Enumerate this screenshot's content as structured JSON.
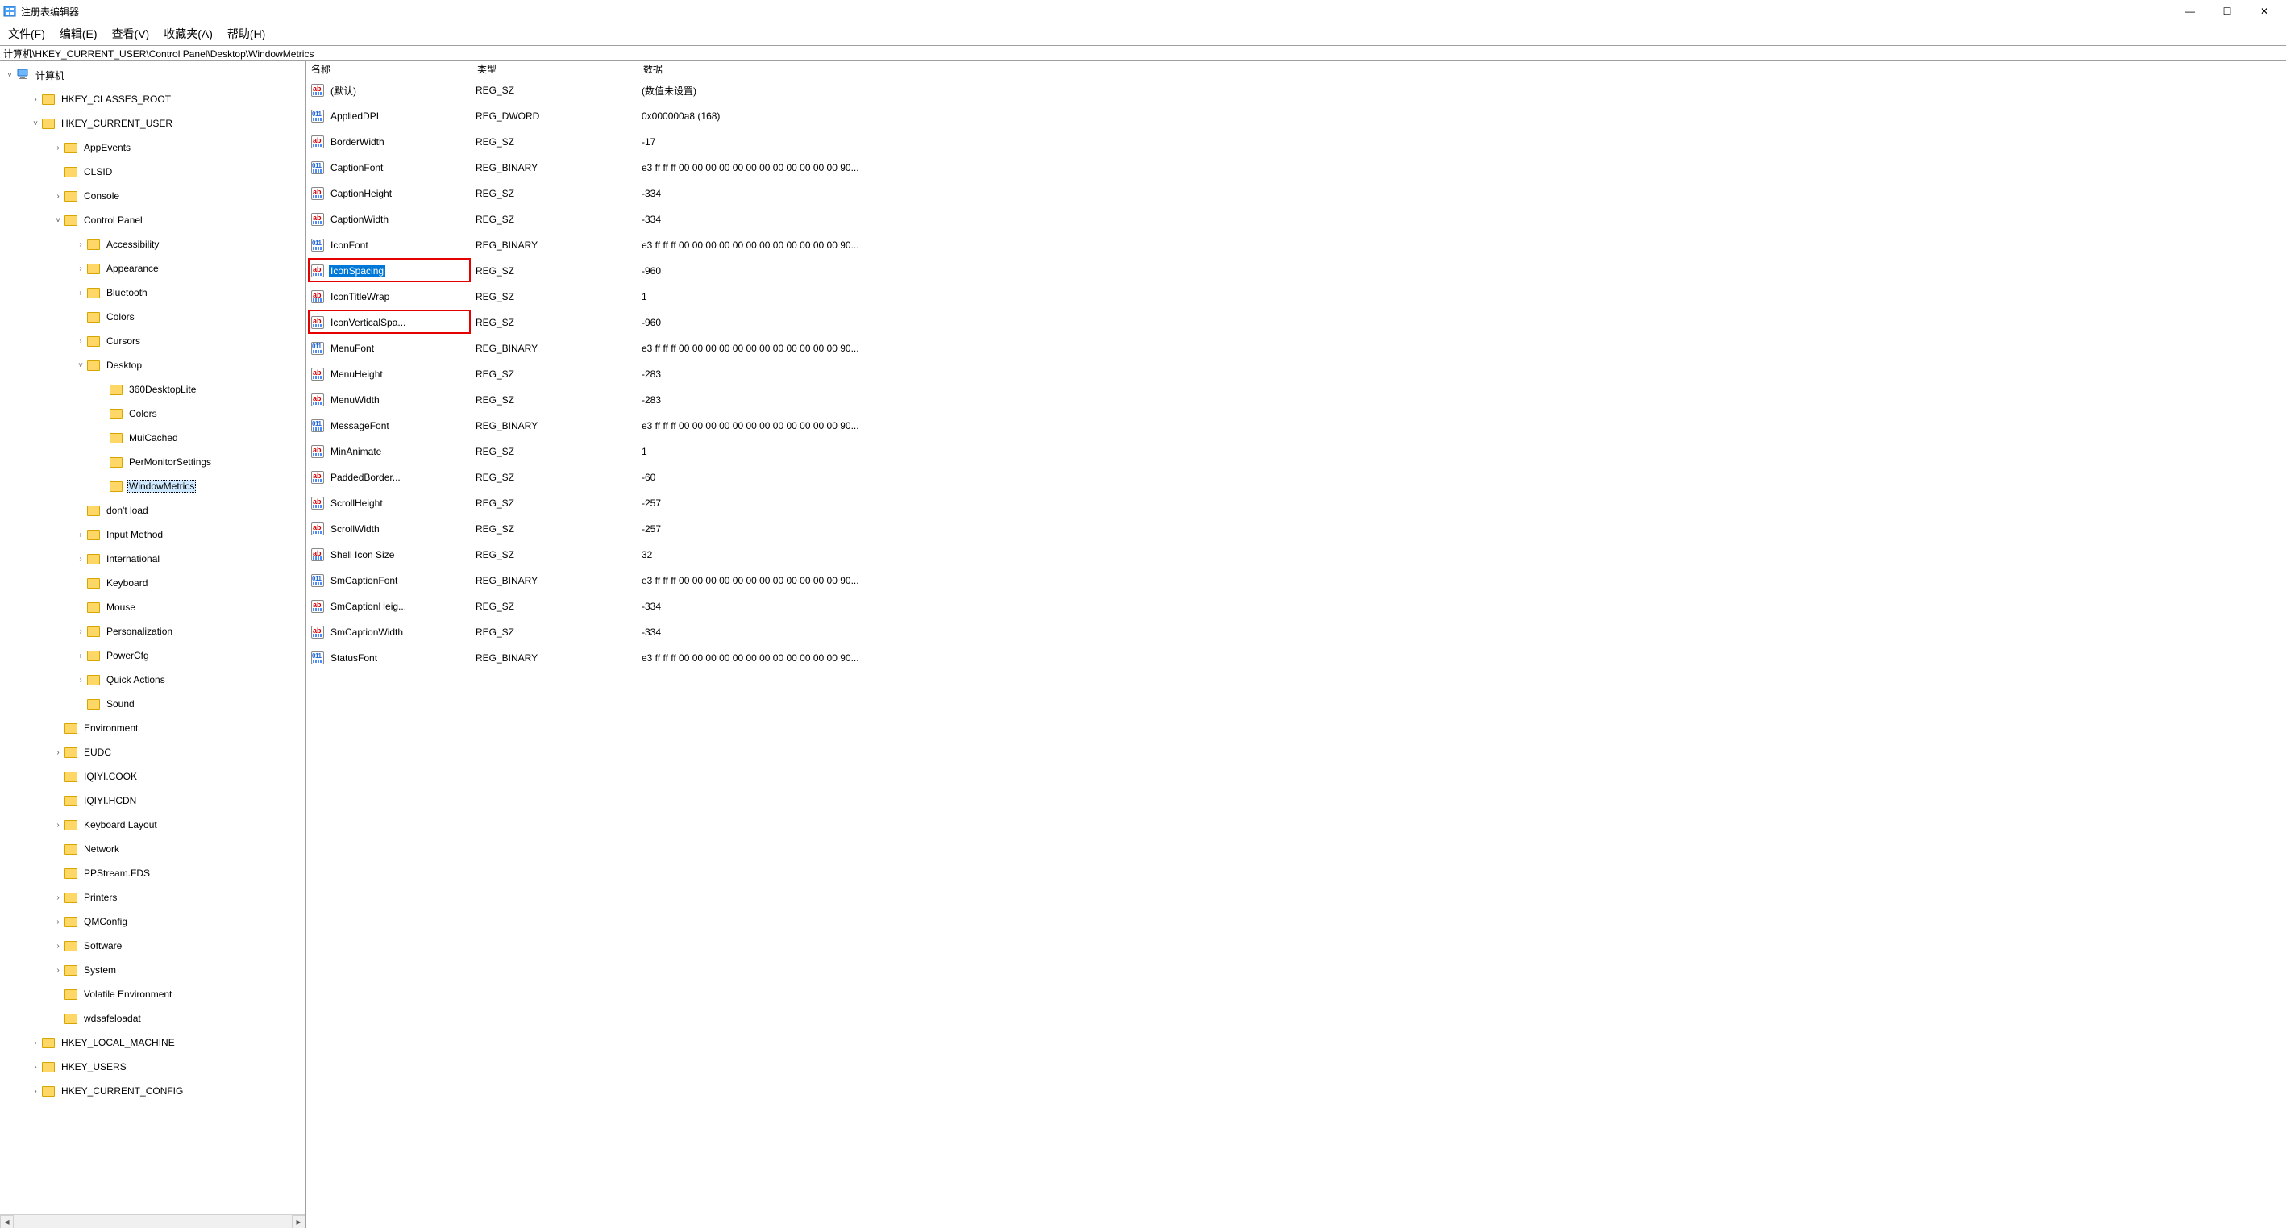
{
  "title": "注册表编辑器",
  "window_controls": {
    "min": "—",
    "max": "☐",
    "close": "✕"
  },
  "menu": {
    "file": "文件(F)",
    "edit": "编辑(E)",
    "view": "查看(V)",
    "favorites": "收藏夹(A)",
    "help": "帮助(H)"
  },
  "address_path": "计算机\\HKEY_CURRENT_USER\\Control Panel\\Desktop\\WindowMetrics",
  "tree": {
    "root": "计算机",
    "items": [
      {
        "expand": ">",
        "label": "HKEY_CLASSES_ROOT",
        "depth": 1
      },
      {
        "expand": "v",
        "label": "HKEY_CURRENT_USER",
        "depth": 1
      },
      {
        "expand": ">",
        "label": "AppEvents",
        "depth": 2
      },
      {
        "expand": "",
        "label": "CLSID",
        "depth": 2
      },
      {
        "expand": ">",
        "label": "Console",
        "depth": 2
      },
      {
        "expand": "v",
        "label": "Control Panel",
        "depth": 2
      },
      {
        "expand": ">",
        "label": "Accessibility",
        "depth": 3
      },
      {
        "expand": ">",
        "label": "Appearance",
        "depth": 3
      },
      {
        "expand": ">",
        "label": "Bluetooth",
        "depth": 3
      },
      {
        "expand": "",
        "label": "Colors",
        "depth": 3
      },
      {
        "expand": ">",
        "label": "Cursors",
        "depth": 3
      },
      {
        "expand": "v",
        "label": "Desktop",
        "depth": 3
      },
      {
        "expand": "",
        "label": "360DesktopLite",
        "depth": 4
      },
      {
        "expand": "",
        "label": "Colors",
        "depth": 4
      },
      {
        "expand": "",
        "label": "MuiCached",
        "depth": 4
      },
      {
        "expand": "",
        "label": "PerMonitorSettings",
        "depth": 4
      },
      {
        "expand": "",
        "label": "WindowMetrics",
        "depth": 4,
        "selected": true
      },
      {
        "expand": "",
        "label": "don't load",
        "depth": 3
      },
      {
        "expand": ">",
        "label": "Input Method",
        "depth": 3
      },
      {
        "expand": ">",
        "label": "International",
        "depth": 3
      },
      {
        "expand": "",
        "label": "Keyboard",
        "depth": 3
      },
      {
        "expand": "",
        "label": "Mouse",
        "depth": 3
      },
      {
        "expand": ">",
        "label": "Personalization",
        "depth": 3
      },
      {
        "expand": ">",
        "label": "PowerCfg",
        "depth": 3
      },
      {
        "expand": ">",
        "label": "Quick Actions",
        "depth": 3
      },
      {
        "expand": "",
        "label": "Sound",
        "depth": 3
      },
      {
        "expand": "",
        "label": "Environment",
        "depth": 2
      },
      {
        "expand": ">",
        "label": "EUDC",
        "depth": 2
      },
      {
        "expand": "",
        "label": "IQIYI.COOK",
        "depth": 2
      },
      {
        "expand": "",
        "label": "IQIYI.HCDN",
        "depth": 2
      },
      {
        "expand": ">",
        "label": "Keyboard Layout",
        "depth": 2
      },
      {
        "expand": "",
        "label": "Network",
        "depth": 2
      },
      {
        "expand": "",
        "label": "PPStream.FDS",
        "depth": 2
      },
      {
        "expand": ">",
        "label": "Printers",
        "depth": 2
      },
      {
        "expand": ">",
        "label": "QMConfig",
        "depth": 2
      },
      {
        "expand": ">",
        "label": "Software",
        "depth": 2
      },
      {
        "expand": ">",
        "label": "System",
        "depth": 2
      },
      {
        "expand": "",
        "label": "Volatile Environment",
        "depth": 2
      },
      {
        "expand": "",
        "label": "wdsafeloadat",
        "depth": 2
      },
      {
        "expand": ">",
        "label": "HKEY_LOCAL_MACHINE",
        "depth": 1
      },
      {
        "expand": ">",
        "label": "HKEY_USERS",
        "depth": 1
      },
      {
        "expand": ">",
        "label": "HKEY_CURRENT_CONFIG",
        "depth": 1
      }
    ]
  },
  "columns": {
    "name": "名称",
    "type": "类型",
    "data": "数据"
  },
  "values": [
    {
      "icon": "sz",
      "name": "(默认)",
      "type": "REG_SZ",
      "data": "(数值未设置)"
    },
    {
      "icon": "bin",
      "name": "AppliedDPI",
      "type": "REG_DWORD",
      "data": "0x000000a8 (168)"
    },
    {
      "icon": "sz",
      "name": "BorderWidth",
      "type": "REG_SZ",
      "data": "-17"
    },
    {
      "icon": "bin",
      "name": "CaptionFont",
      "type": "REG_BINARY",
      "data": "e3 ff ff ff 00 00 00 00 00 00 00 00 00 00 00 00 90..."
    },
    {
      "icon": "sz",
      "name": "CaptionHeight",
      "type": "REG_SZ",
      "data": "-334"
    },
    {
      "icon": "sz",
      "name": "CaptionWidth",
      "type": "REG_SZ",
      "data": "-334"
    },
    {
      "icon": "bin",
      "name": "IconFont",
      "type": "REG_BINARY",
      "data": "e3 ff ff ff 00 00 00 00 00 00 00 00 00 00 00 00 90..."
    },
    {
      "icon": "sz",
      "name": "IconSpacing",
      "type": "REG_SZ",
      "data": "-960",
      "selected": true,
      "redbox": true
    },
    {
      "icon": "sz",
      "name": "IconTitleWrap",
      "type": "REG_SZ",
      "data": "1"
    },
    {
      "icon": "sz",
      "name": "IconVerticalSpa...",
      "type": "REG_SZ",
      "data": "-960",
      "redbox": true
    },
    {
      "icon": "bin",
      "name": "MenuFont",
      "type": "REG_BINARY",
      "data": "e3 ff ff ff 00 00 00 00 00 00 00 00 00 00 00 00 90..."
    },
    {
      "icon": "sz",
      "name": "MenuHeight",
      "type": "REG_SZ",
      "data": "-283"
    },
    {
      "icon": "sz",
      "name": "MenuWidth",
      "type": "REG_SZ",
      "data": "-283"
    },
    {
      "icon": "bin",
      "name": "MessageFont",
      "type": "REG_BINARY",
      "data": "e3 ff ff ff 00 00 00 00 00 00 00 00 00 00 00 00 90..."
    },
    {
      "icon": "sz",
      "name": "MinAnimate",
      "type": "REG_SZ",
      "data": "1"
    },
    {
      "icon": "sz",
      "name": "PaddedBorder...",
      "type": "REG_SZ",
      "data": "-60"
    },
    {
      "icon": "sz",
      "name": "ScrollHeight",
      "type": "REG_SZ",
      "data": "-257"
    },
    {
      "icon": "sz",
      "name": "ScrollWidth",
      "type": "REG_SZ",
      "data": "-257"
    },
    {
      "icon": "sz",
      "name": "Shell Icon Size",
      "type": "REG_SZ",
      "data": "32"
    },
    {
      "icon": "bin",
      "name": "SmCaptionFont",
      "type": "REG_BINARY",
      "data": "e3 ff ff ff 00 00 00 00 00 00 00 00 00 00 00 00 90..."
    },
    {
      "icon": "sz",
      "name": "SmCaptionHeig...",
      "type": "REG_SZ",
      "data": "-334"
    },
    {
      "icon": "sz",
      "name": "SmCaptionWidth",
      "type": "REG_SZ",
      "data": "-334"
    },
    {
      "icon": "bin",
      "name": "StatusFont",
      "type": "REG_BINARY",
      "data": "e3 ff ff ff 00 00 00 00 00 00 00 00 00 00 00 00 90..."
    }
  ]
}
